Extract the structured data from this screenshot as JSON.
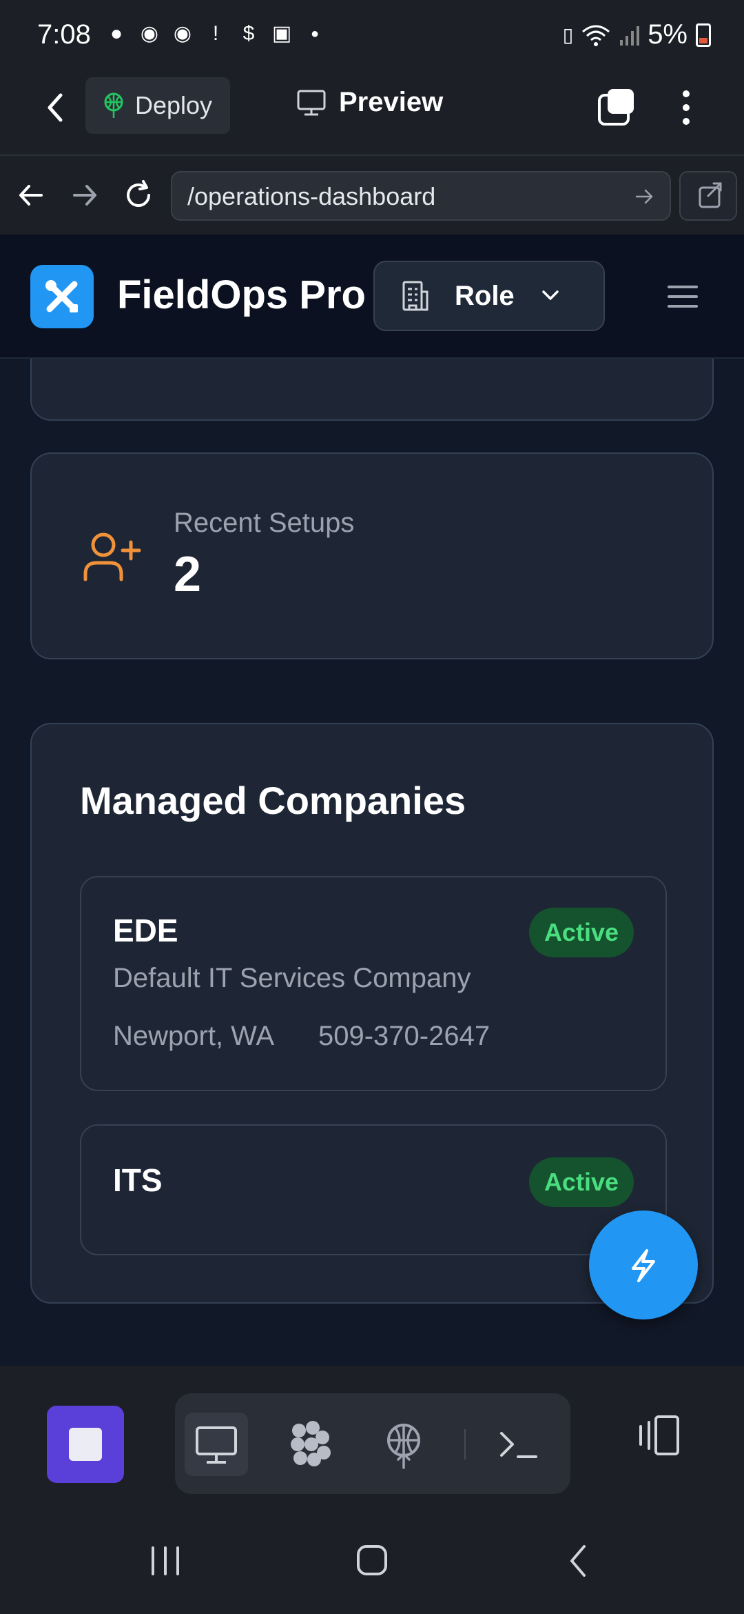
{
  "status_bar": {
    "time": "7:08",
    "battery_percent": "5%",
    "notification_icons": [
      "chat-bubble-icon",
      "messenger-icon",
      "messenger-icon",
      "alert-icon",
      "dollar-icon",
      "image-icon",
      "dot-icon"
    ]
  },
  "topbar": {
    "deploy_label": "Deploy",
    "preview_label": "Preview"
  },
  "browser": {
    "url": "/operations-dashboard"
  },
  "app": {
    "title": "FieldOps Pro",
    "role_label": "Role"
  },
  "stats": {
    "recent_setups_label": "Recent Setups",
    "recent_setups_value": "2"
  },
  "companies": {
    "title": "Managed Companies",
    "items": [
      {
        "name": "EDE",
        "status": "Active",
        "description": "Default IT Services Company",
        "location": "Newport, WA",
        "phone": "509-370-2647"
      },
      {
        "name": "ITS",
        "status": "Active"
      }
    ]
  },
  "colors": {
    "accent": "#2196f3",
    "status_active_bg": "#14532d",
    "status_active_text": "#4ade80",
    "stop_button": "#5b3fd9",
    "setups_icon": "#f0923a"
  }
}
